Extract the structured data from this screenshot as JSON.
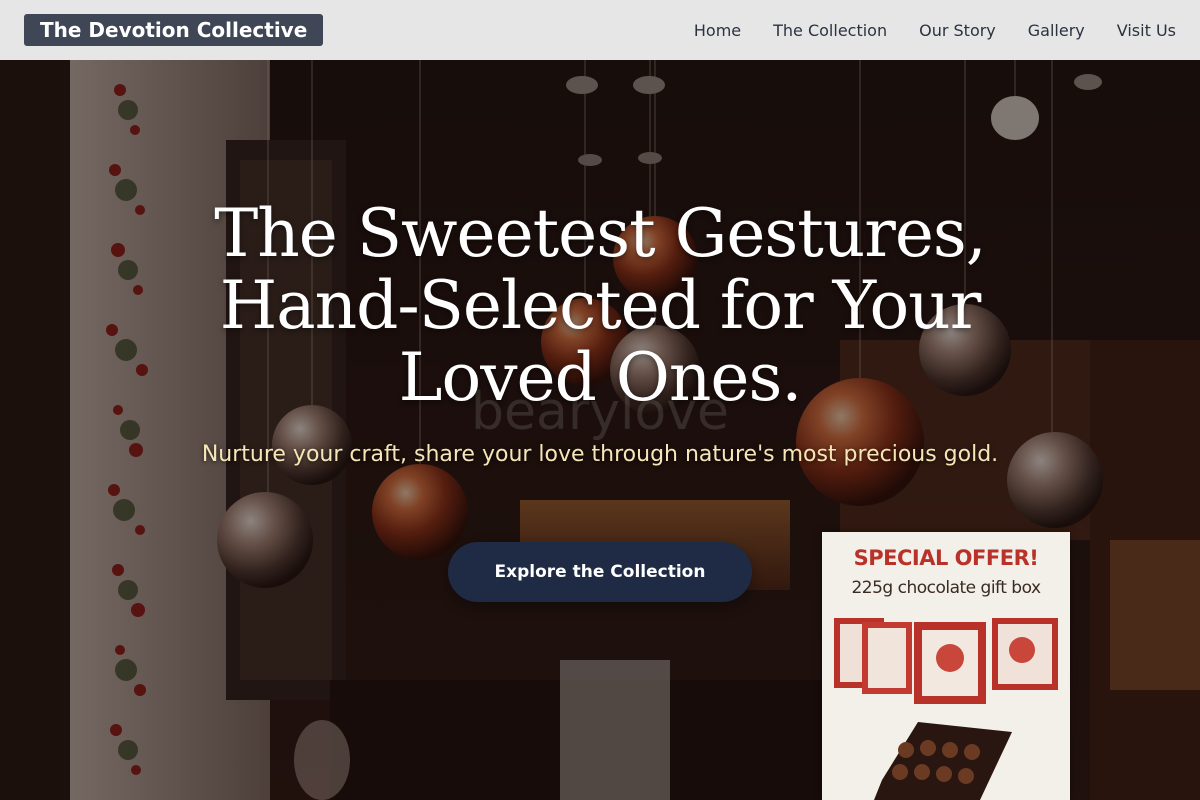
{
  "header": {
    "brand": "The Devotion Collective",
    "nav": [
      {
        "label": "Home"
      },
      {
        "label": "The Collection"
      },
      {
        "label": "Our Story"
      },
      {
        "label": "Gallery"
      },
      {
        "label": "Visit Us"
      }
    ]
  },
  "hero": {
    "title_lines": [
      "The Sweetest Gestures,",
      "Hand-Selected for Your",
      "Loved Ones."
    ],
    "subtitle": "Nurture your craft, share your love through nature's most precious gold.",
    "cta_label": "Explore the Collection"
  },
  "background_photo": {
    "watermark": "bearylove",
    "sign": {
      "title": "SPECIAL OFFER!",
      "subtitle": "225g chocolate gift box"
    }
  },
  "colors": {
    "header_bg": "#e6e6e6",
    "brand_bg": "#3f4655",
    "nav_text": "#2b3240",
    "cta_bg": "#1f2b45",
    "subtitle_text": "#f6e6b8",
    "sign_title": "#b8322a"
  }
}
